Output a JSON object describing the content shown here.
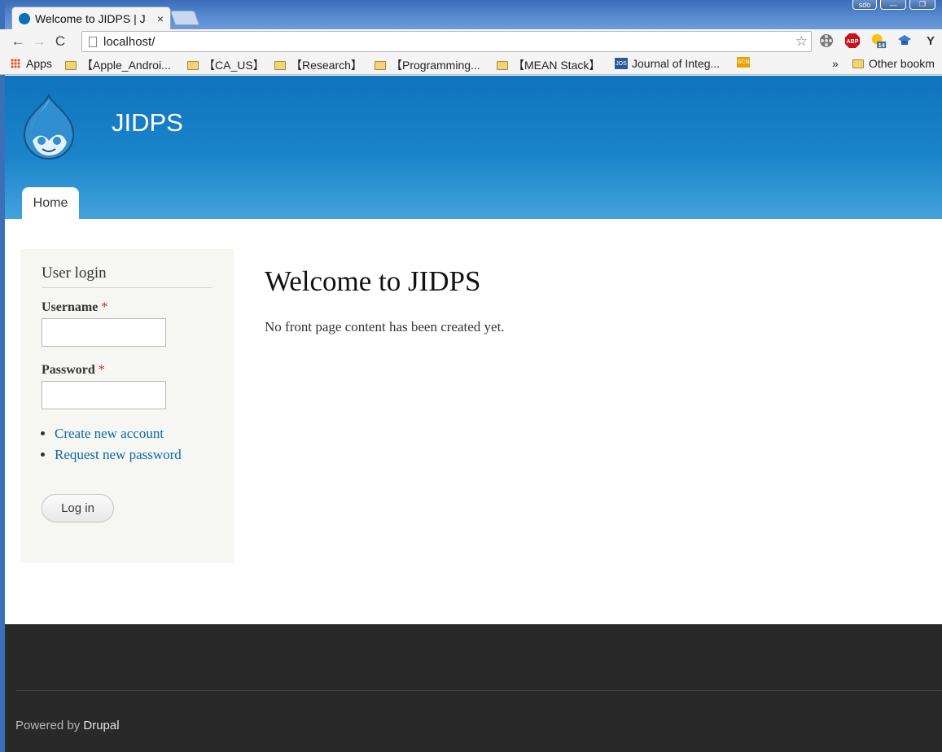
{
  "browser": {
    "tab_title": "Welcome to JIDPS | J",
    "tab_close": "×",
    "window_buttons": [
      "sdo",
      "—",
      "❐"
    ],
    "back_glyph": "←",
    "forward_glyph": "→",
    "reload_glyph": "C",
    "url": "localhost/",
    "star_glyph": "☆",
    "extensions": [
      "ABP",
      "14",
      "Y"
    ],
    "bookmarks": [
      "Apps",
      "【Apple_Androi...",
      "【CA_US】",
      "【Research】",
      "【Programming...",
      "【MEAN Stack】",
      "Journal of Integ..."
    ],
    "jos_label": "JOS",
    "scn_label": "SCN",
    "overflow": "»",
    "other_bookmarks": "Other bookm"
  },
  "site": {
    "name": "JIDPS",
    "nav_tab": "Home"
  },
  "sidebar": {
    "title": "User login",
    "username_label": "Username",
    "password_label": "Password",
    "required_mark": "*",
    "links": [
      "Create new account",
      "Request new password"
    ],
    "login_button": "Log in"
  },
  "content": {
    "title": "Welcome to JIDPS",
    "text": "No front page content has been created yet."
  },
  "footer": {
    "powered_by": "Powered by ",
    "drupal": "Drupal"
  },
  "colors": {
    "header_top": "#0f73bd",
    "header_bottom": "#43a2dd",
    "link": "#0a6aa8",
    "footer_bg": "#292929",
    "sidebar_bg": "#f6f6f2"
  }
}
